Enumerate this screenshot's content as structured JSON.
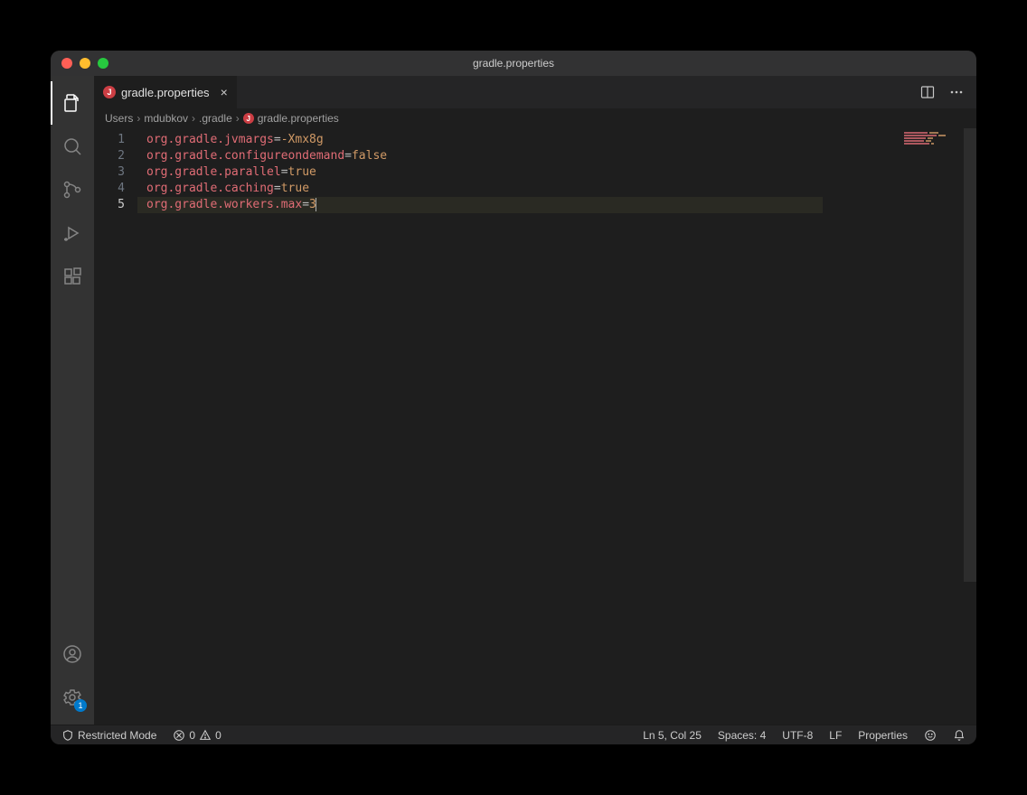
{
  "title": "gradle.properties",
  "tab": {
    "label": "gradle.properties",
    "dirty": true
  },
  "breadcrumbs": {
    "items": [
      "Users",
      "mdubkov",
      ".gradle",
      "gradle.properties"
    ]
  },
  "editor": {
    "lines": [
      {
        "n": "1",
        "key": "org.gradle.jvmargs",
        "eq": "=",
        "val": "-Xmx8g"
      },
      {
        "n": "2",
        "key": "org.gradle.configureondemand",
        "eq": "=",
        "val": "false"
      },
      {
        "n": "3",
        "key": "org.gradle.parallel",
        "eq": "=",
        "val": "true"
      },
      {
        "n": "4",
        "key": "org.gradle.caching",
        "eq": "=",
        "val": "true"
      },
      {
        "n": "5",
        "key": "org.gradle.workers.max",
        "eq": "=",
        "val": "3"
      }
    ],
    "activeLine": 5
  },
  "settings_badge": "1",
  "status": {
    "restricted": "Restricted Mode",
    "errors": "0",
    "warnings": "0",
    "position": "Ln 5, Col 25",
    "spaces": "Spaces: 4",
    "encoding": "UTF-8",
    "eol": "LF",
    "language": "Properties"
  }
}
